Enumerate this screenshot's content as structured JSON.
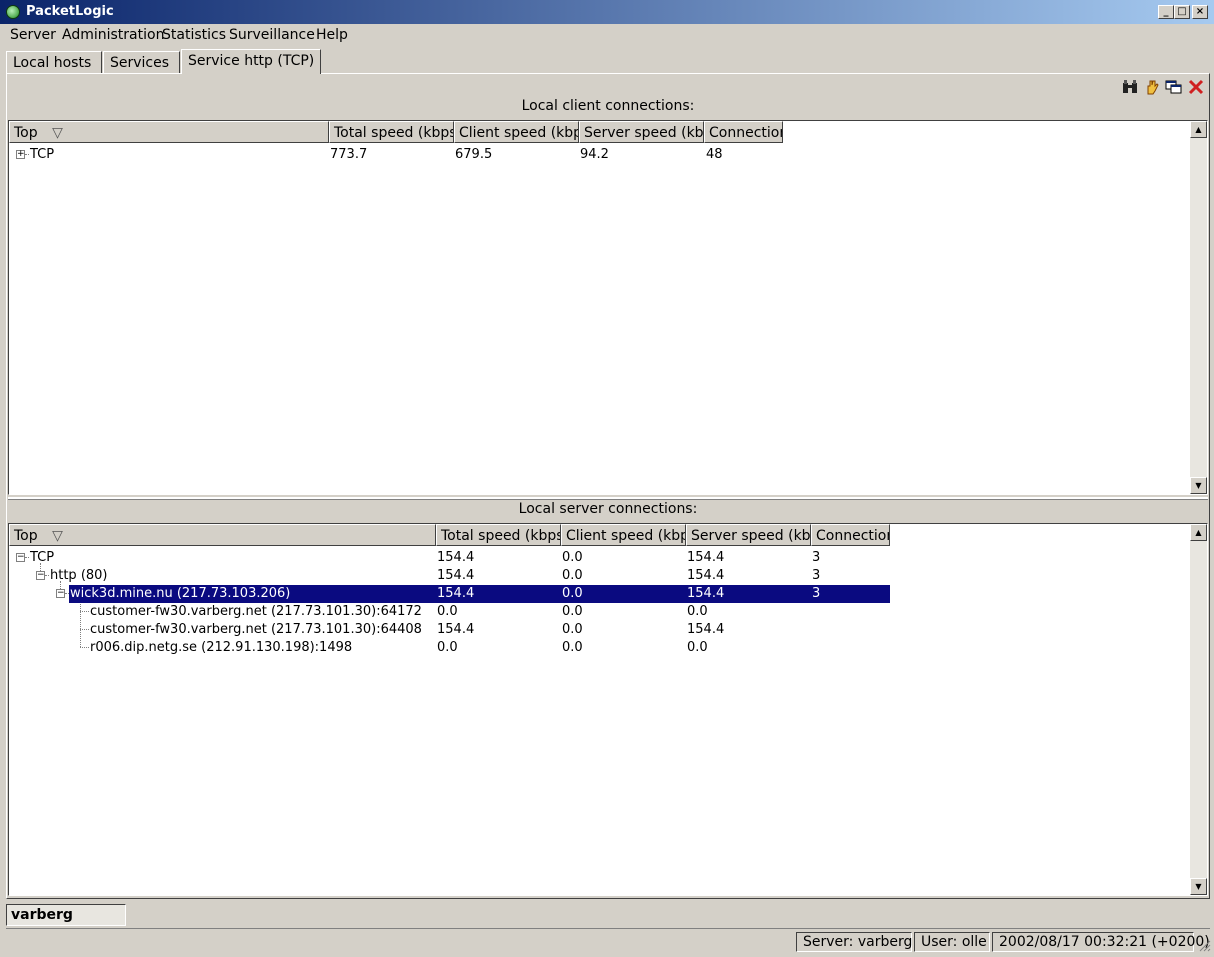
{
  "window": {
    "title": "PacketLogic",
    "minimize": "_",
    "maximize": "□",
    "close": "×"
  },
  "menu": [
    "Server",
    "Administration",
    "Statistics",
    "Surveillance",
    "Help"
  ],
  "tabs": [
    "Local hosts",
    "Services",
    "Service http (TCP)"
  ],
  "toolbar": {
    "icons": [
      "binoculars-icon",
      "hand-icon",
      "window-copy-icon",
      "close-icon"
    ]
  },
  "client_section": {
    "label": "Local client connections:",
    "columns": [
      "Top",
      "Total speed (kbps)",
      "Client speed (kbps)",
      "Server speed (kbps)",
      "Connections"
    ],
    "rows": [
      {
        "name": "TCP",
        "total": "773.7",
        "client": "679.5",
        "server": "94.2",
        "conns": "48"
      }
    ]
  },
  "server_section": {
    "label": "Local server connections:",
    "columns": [
      "Top",
      "Total speed (kbps)",
      "Client speed (kbps)",
      "Server speed (kbps)",
      "Connections"
    ],
    "rows": [
      {
        "name": "TCP",
        "total": "154.4",
        "client": "0.0",
        "server": "154.4",
        "conns": "3"
      },
      {
        "name": "http (80)",
        "total": "154.4",
        "client": "0.0",
        "server": "154.4",
        "conns": "3"
      },
      {
        "name": "wick3d.mine.nu (217.73.103.206)",
        "total": "154.4",
        "client": "0.0",
        "server": "154.4",
        "conns": "3"
      },
      {
        "name": "customer-fw30.varberg.net (217.73.101.30):64172",
        "total": "0.0",
        "client": "0.0",
        "server": "0.0",
        "conns": ""
      },
      {
        "name": "customer-fw30.varberg.net (217.73.101.30):64408",
        "total": "154.4",
        "client": "0.0",
        "server": "154.4",
        "conns": ""
      },
      {
        "name": "r006.dip.netg.se (212.91.130.198):1498",
        "total": "0.0",
        "client": "0.0",
        "server": "0.0",
        "conns": ""
      }
    ]
  },
  "host_field": "varberg",
  "status": {
    "server": "Server: varberg",
    "user": "User: olle",
    "time": "2002/08/17 00:32:21 (+0200)"
  },
  "colors": {
    "title_start": "#0a246a",
    "title_end": "#a6caf0",
    "selection": "#0a0a80",
    "face": "#d4d0c8"
  }
}
